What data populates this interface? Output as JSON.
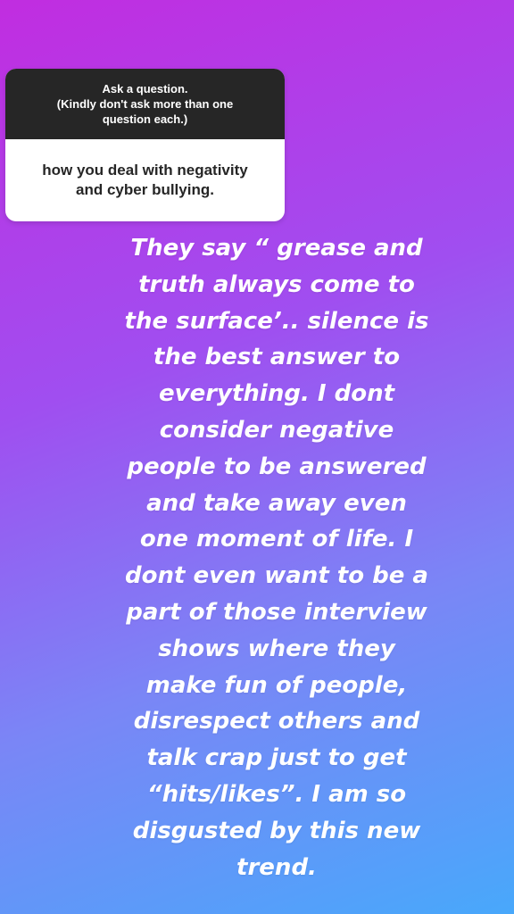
{
  "question_sticker": {
    "prompt": "Ask a question.\n(Kindly don't ask more than one\nquestion each.)",
    "response": "how you deal with negativity\nand cyber bullying."
  },
  "story": {
    "lines": [
      "They say “ grease and",
      "truth always come to",
      "the surface’.. silence is",
      "the best answer to",
      "everything. I dont",
      "consider negative",
      "people to be answered",
      "and take away even",
      "one moment of life. I",
      "dont even want to be a",
      "part of those interview",
      "shows where they",
      "make fun of people,",
      "disrespect others and",
      "talk crap just to get",
      "“hits/likes”. I am so",
      "disgusted by this new",
      "trend."
    ]
  },
  "colors": {
    "gradient_top_left": "#c12de0",
    "gradient_bottom_right": "#48a8fb",
    "sticker_header": "#262626",
    "sticker_body": "#ffffff",
    "story_text": "#ffffff"
  }
}
